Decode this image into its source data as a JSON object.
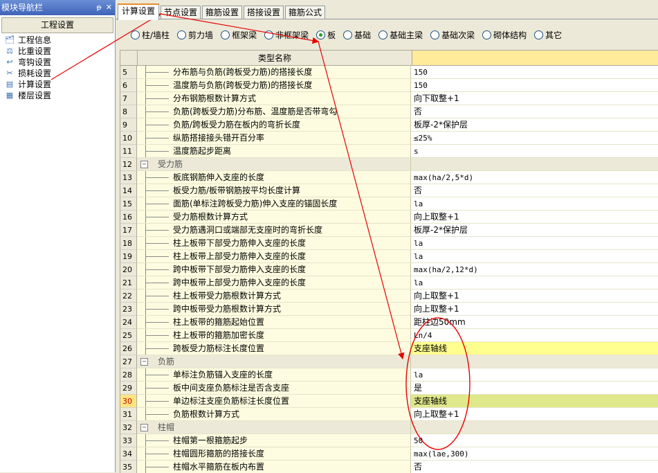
{
  "left_panel": {
    "title": "模块导航栏",
    "controls": [
      "ᵽ",
      "✕"
    ],
    "section": "工程设置",
    "items": [
      {
        "label": "工程信息",
        "icon": "project-info-icon"
      },
      {
        "label": "比重设置",
        "icon": "weight-icon"
      },
      {
        "label": "弯钩设置",
        "icon": "hook-icon"
      },
      {
        "label": "损耗设置",
        "icon": "loss-icon"
      },
      {
        "label": "计算设置",
        "icon": "calc-icon"
      },
      {
        "label": "楼层设置",
        "icon": "floor-icon"
      }
    ]
  },
  "tabs": [
    "计算设置",
    "节点设置",
    "箍筋设置",
    "搭接设置",
    "箍筋公式"
  ],
  "active_tab": 0,
  "radios": [
    {
      "label": "柱/墙柱",
      "checked": false
    },
    {
      "label": "剪力墙",
      "checked": false
    },
    {
      "label": "框架梁",
      "checked": false
    },
    {
      "label": "非框架梁",
      "checked": false
    },
    {
      "label": "板",
      "checked": true
    },
    {
      "label": "基础",
      "checked": false
    },
    {
      "label": "基础主梁",
      "checked": false
    },
    {
      "label": "基础次梁",
      "checked": false
    },
    {
      "label": "砌体结构",
      "checked": false
    },
    {
      "label": "其它",
      "checked": false
    }
  ],
  "table": {
    "header": "类型名称",
    "rows": [
      {
        "no": "5",
        "name": "分布筋与负筋(跨板受力筋)的搭接长度",
        "value": "150"
      },
      {
        "no": "6",
        "name": "温度筋与负筋(跨板受力筋)的搭接长度",
        "value": "150"
      },
      {
        "no": "7",
        "name": "分布钢筋根数计算方式",
        "value": "向下取整+1"
      },
      {
        "no": "8",
        "name": "负筋(跨板受力筋)分布筋、温度筋是否带弯勾",
        "value": "否"
      },
      {
        "no": "9",
        "name": "负筋/跨板受力筋在板内的弯折长度",
        "value": "板厚-2*保护层"
      },
      {
        "no": "10",
        "name": "纵筋搭接接头错开百分率",
        "value": "≤25%"
      },
      {
        "no": "11",
        "name": "温度筋起步距离",
        "value": "s"
      },
      {
        "no": "12",
        "name": "受力筋",
        "value": "",
        "group": true
      },
      {
        "no": "13",
        "name": "板底钢筋伸入支座的长度",
        "value": "max(ha/2,5*d)"
      },
      {
        "no": "14",
        "name": "板受力筋/板带钢筋按平均长度计算",
        "value": "否"
      },
      {
        "no": "15",
        "name": "面筋(单标注跨板受力筋)伸入支座的锚固长度",
        "value": "la"
      },
      {
        "no": "16",
        "name": "受力筋根数计算方式",
        "value": "向上取整+1"
      },
      {
        "no": "17",
        "name": "受力筋遇洞口或端部无支座时的弯折长度",
        "value": "板厚-2*保护层"
      },
      {
        "no": "18",
        "name": "柱上板带下部受力筋伸入支座的长度",
        "value": "la"
      },
      {
        "no": "19",
        "name": "柱上板带上部受力筋伸入支座的长度",
        "value": "la"
      },
      {
        "no": "20",
        "name": "跨中板带下部受力筋伸入支座的长度",
        "value": "max(ha/2,12*d)"
      },
      {
        "no": "21",
        "name": "跨中板带上部受力筋伸入支座的长度",
        "value": "la"
      },
      {
        "no": "22",
        "name": "柱上板带受力筋根数计算方式",
        "value": "向上取整+1"
      },
      {
        "no": "23",
        "name": "跨中板带受力筋根数计算方式",
        "value": "向上取整+1"
      },
      {
        "no": "24",
        "name": "柱上板带的箍筋起始位置",
        "value": "距柱边50mm"
      },
      {
        "no": "25",
        "name": "柱上板带的箍筋加密长度",
        "value": "Ln/4"
      },
      {
        "no": "26",
        "name": "跨板受力筋标注长度位置",
        "value": "支座轴线",
        "highlight": "yellow"
      },
      {
        "no": "27",
        "name": "负筋",
        "value": "",
        "group": true
      },
      {
        "no": "28",
        "name": "单标注负筋锚入支座的长度",
        "value": "la"
      },
      {
        "no": "29",
        "name": "板中间支座负筋标注是否含支座",
        "value": "是"
      },
      {
        "no": "30",
        "name": "单边标注支座负筋标注长度位置",
        "value": "支座轴线",
        "highlight": "green",
        "selected": true
      },
      {
        "no": "31",
        "name": "负筋根数计算方式",
        "value": "向上取整+1"
      },
      {
        "no": "32",
        "name": "柱帽",
        "value": "",
        "group": true
      },
      {
        "no": "33",
        "name": "柱帽第一根箍筋起步",
        "value": "50"
      },
      {
        "no": "34",
        "name": "柱帽圆形箍筋的搭接长度",
        "value": "max(lae,300)"
      },
      {
        "no": "35",
        "name": "柱帽水平箍筋在板内布置",
        "value": "否"
      }
    ]
  },
  "annotation_color": "#e60000"
}
